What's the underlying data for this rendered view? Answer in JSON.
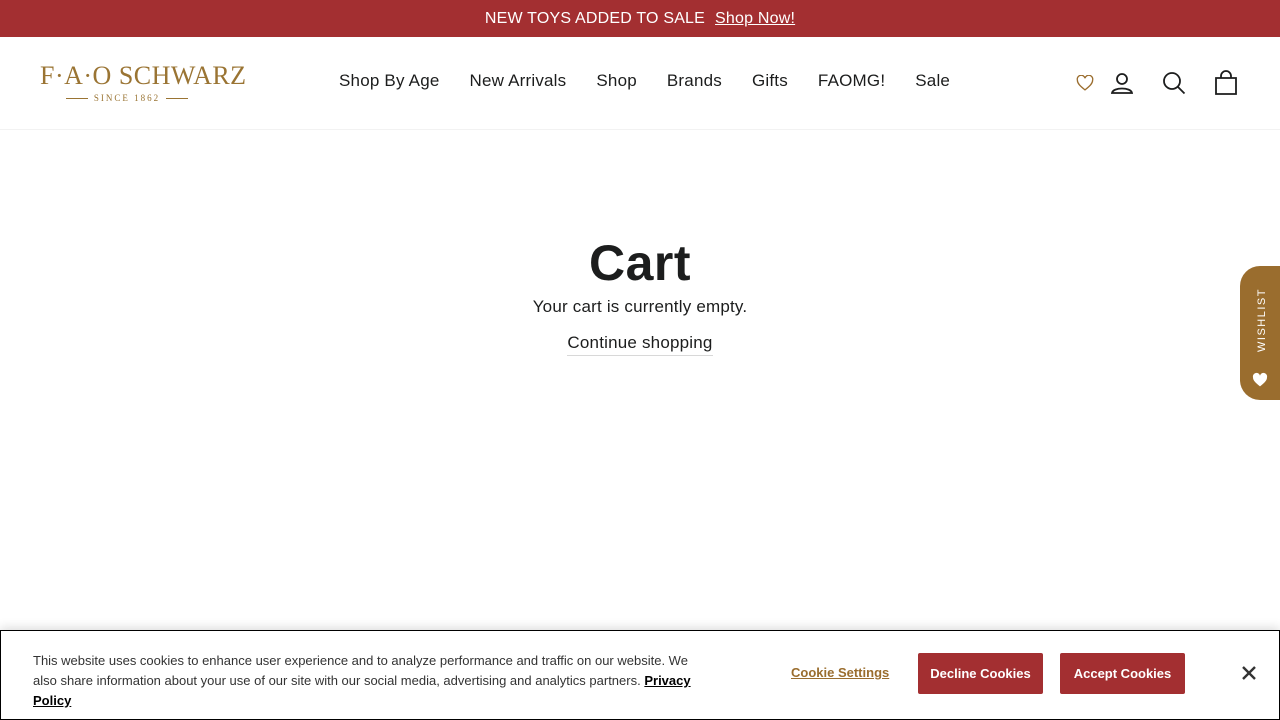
{
  "announcement": {
    "text": "NEW TOYS ADDED TO SALE",
    "link": "Shop Now!"
  },
  "header": {
    "logo_text": "F·A·O SCHWARZ",
    "logo_tagline": "SINCE 1862",
    "nav": [
      {
        "label": "Shop By Age"
      },
      {
        "label": "New Arrivals"
      },
      {
        "label": "Shop"
      },
      {
        "label": "Brands"
      },
      {
        "label": "Gifts"
      },
      {
        "label": "FAOMG!"
      },
      {
        "label": "Sale"
      }
    ],
    "icons": [
      "heart-icon",
      "account-icon",
      "search-icon",
      "cart-icon"
    ]
  },
  "main": {
    "title": "Cart",
    "empty_message": "Your cart is currently empty.",
    "continue_link": "Continue shopping"
  },
  "wishlist_tab": {
    "label": "WISHLIST"
  },
  "cookie_banner": {
    "text": "This website uses cookies to enhance user experience and to analyze performance and traffic on our website. We also share information about your use of our site with our social media, advertising and analytics partners.",
    "privacy_link": "Privacy Policy",
    "settings_label": "Cookie Settings",
    "decline_label": "Decline Cookies",
    "accept_label": "Accept Cookies"
  },
  "colors": {
    "brand_red": "#a32f31",
    "brand_gold": "#9a7433",
    "wishlist_tab": "#9a6d2e",
    "text": "#1c1d1d"
  }
}
